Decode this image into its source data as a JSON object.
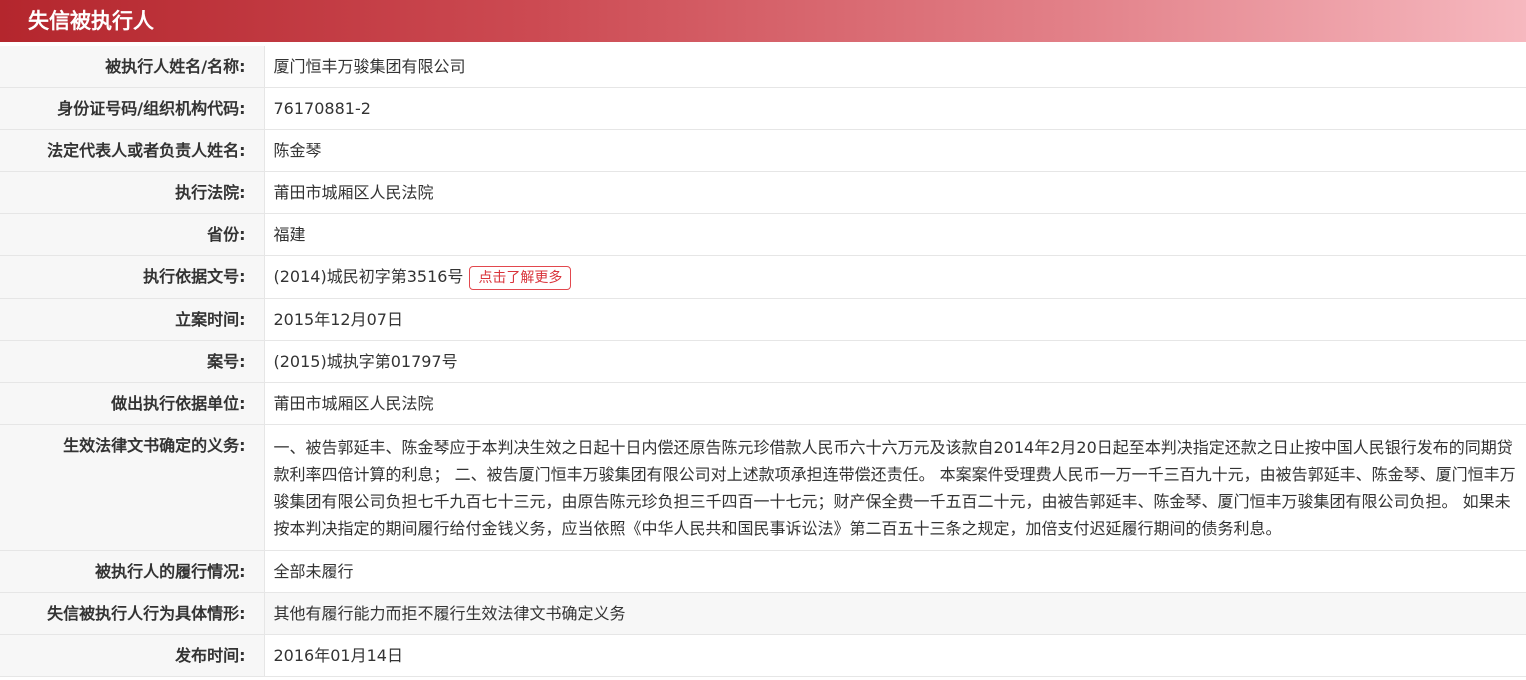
{
  "header": {
    "title": "失信被执行人"
  },
  "rows": [
    {
      "label": "被执行人姓名/名称:",
      "value": "厦门恒丰万骏集团有限公司"
    },
    {
      "label": "身份证号码/组织机构代码:",
      "value": "76170881-2"
    },
    {
      "label": "法定代表人或者负责人姓名:",
      "value": "陈金琴"
    },
    {
      "label": "执行法院:",
      "value": "莆田市城厢区人民法院"
    },
    {
      "label": "省份:",
      "value": "福建"
    },
    {
      "label": "执行依据文号:",
      "value": "(2014)城民初字第3516号",
      "button": "点击了解更多"
    },
    {
      "label": "立案时间:",
      "value": "2015年12月07日"
    },
    {
      "label": "案号:",
      "value": "(2015)城执字第01797号"
    },
    {
      "label": "做出执行依据单位:",
      "value": "莆田市城厢区人民法院"
    },
    {
      "label": "生效法律文书确定的义务:",
      "value": "一、被告郭延丰、陈金琴应于本判决生效之日起十日内偿还原告陈元珍借款人民币六十六万元及该款自2014年2月20日起至本判决指定还款之日止按中国人民银行发布的同期贷款利率四倍计算的利息； 二、被告厦门恒丰万骏集团有限公司对上述款项承担连带偿还责任。 本案案件受理费人民币一万一千三百九十元，由被告郭延丰、陈金琴、厦门恒丰万骏集团有限公司负担七千九百七十三元，由原告陈元珍负担三千四百一十七元；财产保全费一千五百二十元，由被告郭延丰、陈金琴、厦门恒丰万骏集团有限公司负担。 如果未按本判决指定的期间履行给付金钱义务，应当依照《中华人民共和国民事诉讼法》第二百五十三条之规定，加倍支付迟延履行期间的债务利息。"
    },
    {
      "label": "被执行人的履行情况:",
      "value": "全部未履行"
    },
    {
      "label": "失信被执行人行为具体情形:",
      "value": "其他有履行能力而拒不履行生效法律文书确定义务"
    },
    {
      "label": "发布时间:",
      "value": "2016年01月14日"
    }
  ]
}
